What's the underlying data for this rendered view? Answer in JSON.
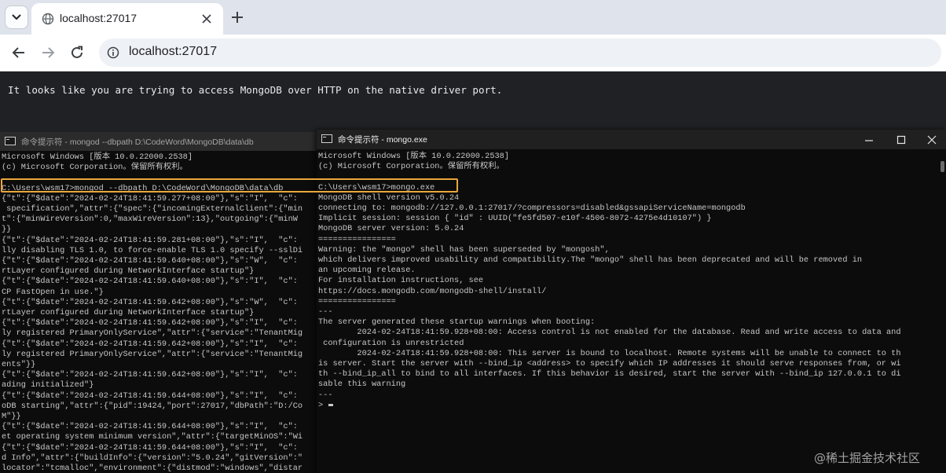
{
  "browser": {
    "tab_title": "localhost:27017",
    "url": "localhost:27017",
    "icons": [
      "chevron-down-icon",
      "globe-icon",
      "close-icon",
      "plus-icon",
      "back-arrow-icon",
      "forward-arrow-icon",
      "reload-icon",
      "info-icon"
    ]
  },
  "page": {
    "message": "It looks like you are trying to access MongoDB over HTTP on the native driver port."
  },
  "terminal_left": {
    "title": "命令提示符 - mongod  --dbpath D:\\CodeWord\\MongoDB\\data\\db",
    "lines": [
      "Microsoft Windows [版本 10.0.22000.2538]",
      "(c) Microsoft Corporation。保留所有权利。",
      "",
      "C:\\Users\\wsm17>mongod --dbpath D:\\CodeWord\\MongoDB\\data\\db",
      "{\"t\":{\"$date\":\"2024-02-24T18:41:59.277+08:00\"},\"s\":\"I\",  \"c\":",
      " specification\",\"attr\":{\"spec\":{\"incomingExternalClient\":{\"min",
      "t\":{\"minWireVersion\":0,\"maxWireVersion\":13},\"outgoing\":{\"minW",
      "}}",
      "{\"t\":{\"$date\":\"2024-02-24T18:41:59.281+08:00\"},\"s\":\"I\",  \"c\":",
      "lly disabling TLS 1.0, to force-enable TLS 1.0 specify --sslDi",
      "{\"t\":{\"$date\":\"2024-02-24T18:41:59.640+08:00\"},\"s\":\"W\",  \"c\":",
      "rtLayer configured during NetworkInterface startup\"}",
      "{\"t\":{\"$date\":\"2024-02-24T18:41:59.640+08:00\"},\"s\":\"I\",  \"c\":",
      "CP FastOpen in use.\"}",
      "{\"t\":{\"$date\":\"2024-02-24T18:41:59.642+08:00\"},\"s\":\"W\",  \"c\":",
      "rtLayer configured during NetworkInterface startup\"}",
      "{\"t\":{\"$date\":\"2024-02-24T18:41:59.642+08:00\"},\"s\":\"I\",  \"c\":",
      "ly registered PrimaryOnlyService\",\"attr\":{\"service\":\"TenantMig",
      "{\"t\":{\"$date\":\"2024-02-24T18:41:59.642+08:00\"},\"s\":\"I\",  \"c\":",
      "ly registered PrimaryOnlyService\",\"attr\":{\"service\":\"TenantMig",
      "ents\"}}",
      "{\"t\":{\"$date\":\"2024-02-24T18:41:59.642+08:00\"},\"s\":\"I\",  \"c\":",
      "ading initialized\"}",
      "{\"t\":{\"$date\":\"2024-02-24T18:41:59.644+08:00\"},\"s\":\"I\",  \"c\":",
      "oDB starting\",\"attr\":{\"pid\":19424,\"port\":27017,\"dbPath\":\"D:/Co",
      "M\"}}",
      "{\"t\":{\"$date\":\"2024-02-24T18:41:59.644+08:00\"},\"s\":\"I\",  \"c\":",
      "et operating system minimum version\",\"attr\":{\"targetMinOS\":\"Wi",
      "{\"t\":{\"$date\":\"2024-02-24T18:41:59.644+08:00\"},\"s\":\"I\",  \"c\":",
      "d Info\",\"attr\":{\"buildInfo\":{\"version\":\"5.0.24\",\"gitVersion\":\"",
      "locator\":\"tcmalloc\",\"environment\":{\"distmod\":\"windows\",\"distar"
    ]
  },
  "terminal_right": {
    "title": "命令提示符 - mongo.exe",
    "lines": [
      "Microsoft Windows [版本 10.0.22000.2538]",
      "(c) Microsoft Corporation。保留所有权利。",
      "",
      "C:\\Users\\wsm17>mongo.exe",
      "MongoDB shell version v5.0.24",
      "connecting to: mongodb://127.0.0.1:27017/?compressors=disabled&gssapiServiceName=mongodb",
      "Implicit session: session { \"id\" : UUID(\"fe5fd507-e10f-4506-8072-4275e4d10107\") }",
      "MongoDB server version: 5.0.24",
      "================",
      "Warning: the \"mongo\" shell has been superseded by \"mongosh\",",
      "which delivers improved usability and compatibility.The \"mongo\" shell has been deprecated and will be removed in",
      "an upcoming release.",
      "For installation instructions, see",
      "https://docs.mongodb.com/mongodb-shell/install/",
      "================",
      "---",
      "The server generated these startup warnings when booting:",
      "        2024-02-24T18:41:59.928+08:00: Access control is not enabled for the database. Read and write access to data and",
      " configuration is unrestricted",
      "        2024-02-24T18:41:59.928+08:00: This server is bound to localhost. Remote systems will be unable to connect to th",
      "is server. Start the server with --bind_ip <address> to specify which IP addresses it should serve responses from, or wi",
      "th --bind_ip_all to bind to all interfaces. If this behavior is desired, start the server with --bind_ip 127.0.0.1 to di",
      "sable this warning",
      "---"
    ],
    "prompt": ">",
    "window_controls": [
      "minimize-icon",
      "maximize-icon",
      "close-icon"
    ]
  },
  "watermark": "@稀土掘金技术社区",
  "colors": {
    "highlight": "#e9a73a",
    "console_bg": "#0c0c0c",
    "page_bg": "#202124"
  }
}
